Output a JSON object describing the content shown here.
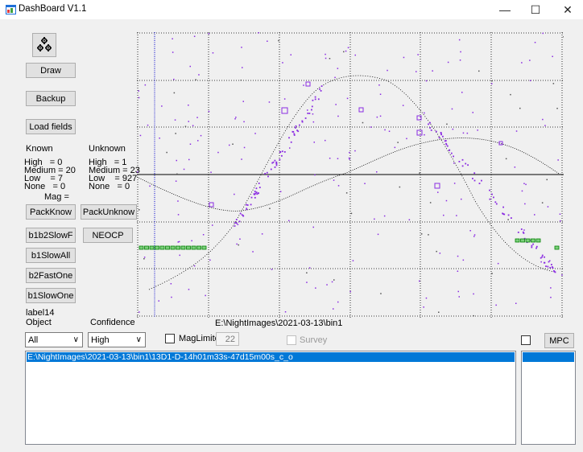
{
  "window": {
    "title": "DashBoard V1.1"
  },
  "buttons": {
    "draw": "Draw",
    "backup": "Backup",
    "load_fields": "Load fields",
    "pack_know": "PackKnow",
    "pack_unknow": "PackUnknow",
    "b1b2slowf": "b1b2SlowF",
    "neocp": "NEOCP",
    "b1slowall": "b1SlowAll",
    "b2fastone": "b2FastOne",
    "b1slowone": "b1SlowOne",
    "mpc": "MPC"
  },
  "stats": {
    "known": {
      "header": "Known",
      "high": "High   = 0",
      "medium": "Medium = 20",
      "low": "Low    = 7",
      "none": "None   = 0"
    },
    "unknown": {
      "header": "Unknown",
      "high": "High   = 1",
      "medium": "Medium = 23",
      "low": "Low    = 927",
      "none": "None   = 0"
    },
    "mag": "Mag ="
  },
  "labels": {
    "label14": "label14",
    "object": "Object",
    "confidence": "Confidence",
    "path": "E:\\NightImages\\2021-03-13\\bin1",
    "maglimite": "MagLimite",
    "survey": "Survey"
  },
  "controls": {
    "object_value": "All",
    "confidence_value": "High",
    "maglimite_value": "22"
  },
  "list": {
    "items": [
      "E:\\NightImages\\2021-03-13\\bin1\\13D1-D-14h01m33s-47d15m00s_c_o"
    ]
  },
  "colors": {
    "accent": "#0078d7",
    "points": "#8a2be2",
    "markers": "#008000",
    "vline": "#0000cc"
  }
}
